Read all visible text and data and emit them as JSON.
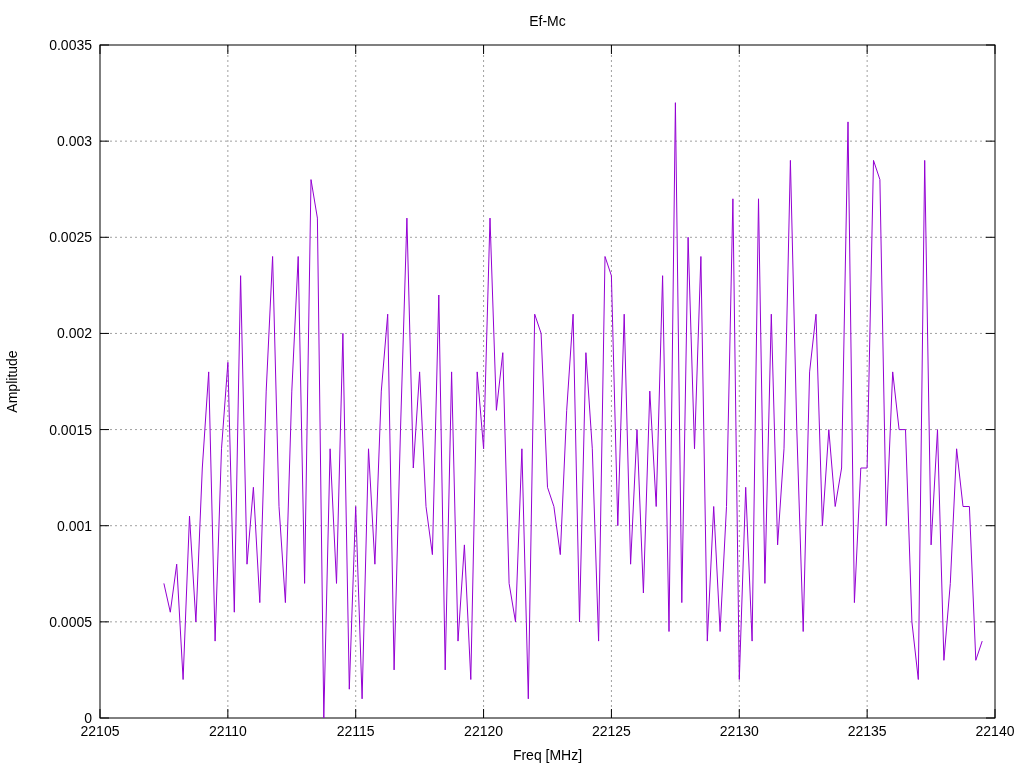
{
  "chart_data": {
    "type": "line",
    "grid": true,
    "title": "Ef-Mc",
    "xlabel": "Freq [MHz]",
    "ylabel": "Amplitude",
    "xlim": [
      22105,
      22140
    ],
    "ylim": [
      0,
      0.0035
    ],
    "xticks": [
      22105,
      22110,
      22115,
      22120,
      22125,
      22130,
      22135,
      22140
    ],
    "yticks": [
      0,
      0.0005,
      0.001,
      0.0015,
      0.002,
      0.0025,
      0.003,
      0.0035
    ],
    "x": [
      22107.5,
      22107.75,
      22108,
      22108.25,
      22108.5,
      22108.75,
      22109,
      22109.25,
      22109.5,
      22109.75,
      22110,
      22110.25,
      22110.5,
      22110.75,
      22111,
      22111.25,
      22111.5,
      22111.75,
      22112,
      22112.25,
      22112.5,
      22112.75,
      22113,
      22113.25,
      22113.5,
      22113.75,
      22114,
      22114.25,
      22114.5,
      22114.75,
      22115,
      22115.25,
      22115.5,
      22115.75,
      22116,
      22116.25,
      22116.5,
      22116.75,
      22117,
      22117.25,
      22117.5,
      22117.75,
      22118,
      22118.25,
      22118.5,
      22118.75,
      22119,
      22119.25,
      22119.5,
      22119.75,
      22120,
      22120.25,
      22120.5,
      22120.75,
      22121,
      22121.25,
      22121.5,
      22121.75,
      22122,
      22122.25,
      22122.5,
      22122.75,
      22123,
      22123.25,
      22123.5,
      22123.75,
      22124,
      22124.25,
      22124.5,
      22124.75,
      22125,
      22125.25,
      22125.5,
      22125.75,
      22126,
      22126.25,
      22126.5,
      22126.75,
      22127,
      22127.25,
      22127.5,
      22127.75,
      22128,
      22128.25,
      22128.5,
      22128.75,
      22129,
      22129.25,
      22129.5,
      22129.75,
      22130,
      22130.25,
      22130.5,
      22130.75,
      22131,
      22131.25,
      22131.5,
      22131.75,
      22132,
      22132.25,
      22132.5,
      22132.75,
      22133,
      22133.25,
      22133.5,
      22133.75,
      22134,
      22134.25,
      22134.5,
      22134.75,
      22135,
      22135.25,
      22135.5,
      22135.75,
      22136,
      22136.25,
      22136.5,
      22136.75,
      22137,
      22137.25,
      22137.5,
      22137.75,
      22138,
      22138.25,
      22138.5,
      22138.75,
      22139,
      22139.25,
      22139.5
    ],
    "series": [
      {
        "color": "#9400d3",
        "values": [
          0.0007,
          0.00055,
          0.0008,
          0.0002,
          0.00105,
          0.0005,
          0.0013,
          0.0018,
          0.0004,
          0.0014,
          0.00185,
          0.00055,
          0.0023,
          0.0008,
          0.0012,
          0.0006,
          0.0017,
          0.0024,
          0.0011,
          0.0006,
          0.0017,
          0.0024,
          0.0007,
          0.0028,
          0.0026,
          0.0,
          0.0014,
          0.0007,
          0.002,
          0.00015,
          0.0011,
          0.0001,
          0.0014,
          0.0008,
          0.0017,
          0.0021,
          0.00025,
          0.0015,
          0.0026,
          0.0013,
          0.0018,
          0.0011,
          0.00085,
          0.0022,
          0.00025,
          0.0018,
          0.0004,
          0.0009,
          0.0002,
          0.0018,
          0.0014,
          0.0026,
          0.0016,
          0.0019,
          0.0007,
          0.0005,
          0.0014,
          0.0001,
          0.0021,
          0.002,
          0.0012,
          0.0011,
          0.00085,
          0.0016,
          0.0021,
          0.0005,
          0.0019,
          0.0014,
          0.0004,
          0.0024,
          0.0023,
          0.001,
          0.0021,
          0.0008,
          0.0015,
          0.00065,
          0.0017,
          0.0011,
          0.0023,
          0.00045,
          0.0032,
          0.0006,
          0.0025,
          0.0014,
          0.0024,
          0.0004,
          0.0011,
          0.00045,
          0.0011,
          0.0027,
          0.0002,
          0.0012,
          0.0004,
          0.0027,
          0.0007,
          0.0021,
          0.0009,
          0.0014,
          0.0029,
          0.0015,
          0.00045,
          0.0018,
          0.0021,
          0.001,
          0.0015,
          0.0011,
          0.0013,
          0.0031,
          0.0006,
          0.0013,
          0.0013,
          0.0029,
          0.0028,
          0.001,
          0.0018,
          0.0015,
          0.0015,
          0.0005,
          0.0002,
          0.0029,
          0.0009,
          0.0015,
          0.0003,
          0.0007,
          0.0014,
          0.0011,
          0.0011,
          0.0003,
          0.0004
        ]
      }
    ]
  }
}
